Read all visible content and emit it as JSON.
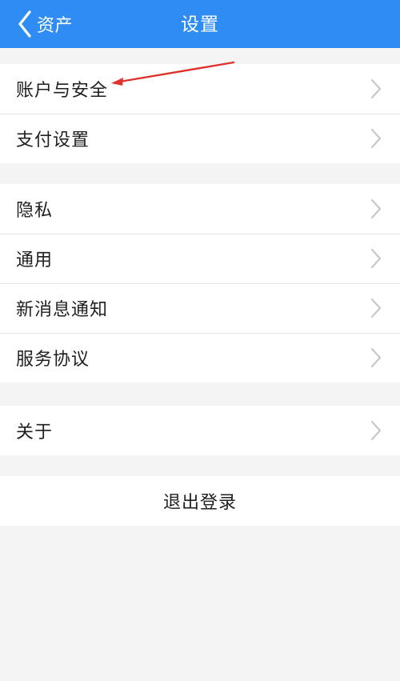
{
  "header": {
    "back_label": "资产",
    "title": "设置",
    "background": "#2f8cf3"
  },
  "groups": [
    {
      "items": [
        {
          "label": "账户与安全"
        },
        {
          "label": "支付设置"
        }
      ]
    },
    {
      "items": [
        {
          "label": "隐私"
        },
        {
          "label": "通用"
        },
        {
          "label": "新消息通知"
        },
        {
          "label": "服务协议"
        }
      ]
    },
    {
      "items": [
        {
          "label": "关于"
        }
      ]
    }
  ],
  "logout": {
    "label": "退出登录"
  },
  "annotation": {
    "color": "#e0322c",
    "icon": "red-arrow"
  }
}
